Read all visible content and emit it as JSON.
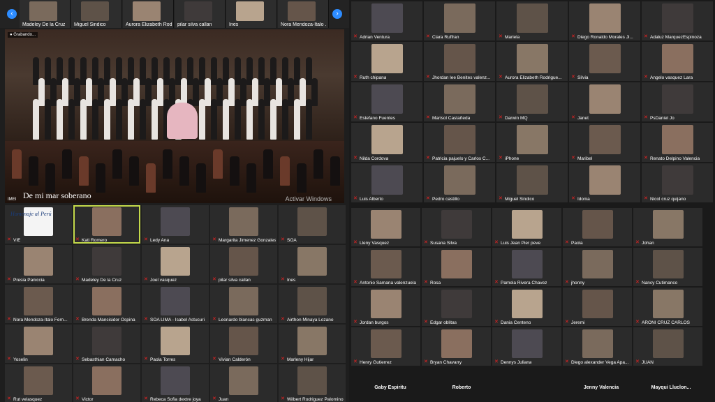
{
  "colors": {
    "accent": "#2d8cff",
    "muted_mic": "#e22222",
    "tile_bg": "#2b2b2b"
  },
  "top_strip": {
    "prev_icon": "chevron-left-icon",
    "next_icon": "chevron-right-icon",
    "participants": [
      "Madeley De la Cruz",
      "Miguel Sindico",
      "Aurora Elizabeth Rodri...",
      "pilar silva callan",
      "Ines",
      "Nora Mendoza-Italo ..."
    ]
  },
  "stage": {
    "recording_label": "Grabando...",
    "caption": "De mi mar soberano",
    "watermark": "Activar Windows",
    "active_name": "IMEI"
  },
  "left_grid": [
    {
      "name": "VIE"
    },
    {
      "name": "Kati Romero"
    },
    {
      "name": "Ledy Ana"
    },
    {
      "name": "Margarita Jimenez Gonzales"
    },
    {
      "name": "SOA"
    },
    {
      "name": "Presia Paniccia"
    },
    {
      "name": "Madeley De la Cruz"
    },
    {
      "name": "Joel vasquez"
    },
    {
      "name": "pilar silva callan"
    },
    {
      "name": "Ines"
    },
    {
      "name": "Nora Mendoza-Italo Fern..."
    },
    {
      "name": "Brenda Mancisidor Ospina"
    },
    {
      "name": "SOA LIMA - Isabel Astucuri"
    },
    {
      "name": "Leonardo blancas guzman"
    },
    {
      "name": "Airthon Minaya Lozano"
    },
    {
      "name": "Yoselin"
    },
    {
      "name": "Sebasthian Camacho"
    },
    {
      "name": "Paola Torres"
    },
    {
      "name": "Vivian Calderón"
    },
    {
      "name": "Marleny Hijar"
    },
    {
      "name": "Rut velasquez"
    },
    {
      "name": "Victor"
    },
    {
      "name": "Rebeca Sofia dextre joya"
    },
    {
      "name": "Juan"
    },
    {
      "name": "Wilbert Rodriguez Palomino"
    }
  ],
  "vie_banner": "Homenaje al Perú",
  "right_grid_top": [
    {
      "name": "Adrian Ventura"
    },
    {
      "name": "Clara Ruffran"
    },
    {
      "name": "Mariela"
    },
    {
      "name": "Diego Ronaldo Morales Ji..."
    },
    {
      "name": "Adaluz MarquezEspinoza"
    },
    {
      "name": "Ruth chipana"
    },
    {
      "name": "Jhordan lee Benites valenz..."
    },
    {
      "name": "Aurora Elizabeth Rodrigue..."
    },
    {
      "name": "Silvia"
    },
    {
      "name": "Angelo vasquez Lara"
    },
    {
      "name": "Estefano Fuentes"
    },
    {
      "name": "Marisol Castañeda"
    },
    {
      "name": "Darwin MQ"
    },
    {
      "name": "Janet"
    },
    {
      "name": "PsDaniel Jo"
    },
    {
      "name": "Nilda Cordova"
    },
    {
      "name": "Patricia pajuelo y Carlos C..."
    },
    {
      "name": "iPhone"
    },
    {
      "name": "Maribel"
    },
    {
      "name": "Renato Delpino Valencia"
    },
    {
      "name": "Luis Alberto"
    },
    {
      "name": "Pedro castillo"
    },
    {
      "name": "Miguel Sindico"
    },
    {
      "name": "Idonia"
    },
    {
      "name": "Nicol cruz quijano"
    }
  ],
  "right_grid_bottom": [
    {
      "name": "Lleny Vasquez"
    },
    {
      "name": "Susana Silva"
    },
    {
      "name": "Luis Jean Pier peve"
    },
    {
      "name": "Paola"
    },
    {
      "name": "Johan"
    },
    {
      "name": "Antonio Samana valenzuela"
    },
    {
      "name": "Rosa"
    },
    {
      "name": "Pamela Rivera Chavez"
    },
    {
      "name": "jhonny"
    },
    {
      "name": "Nancy Cutimanco"
    },
    {
      "name": "Jordan burgos"
    },
    {
      "name": "Edgar oblitas"
    },
    {
      "name": "Dania Centeno"
    },
    {
      "name": "Jeremi"
    },
    {
      "name": "ARONI CRUZ CARLOS"
    },
    {
      "name": "Henry Gutierrez"
    },
    {
      "name": "Bryan Chavarry"
    },
    {
      "name": "Dennys Juliana"
    },
    {
      "name": "Diego alexander Vega Apa..."
    },
    {
      "name": "JUAN"
    }
  ],
  "right_names_only": [
    "Gaby Espiritu",
    "Roberto",
    "Jenny Valencia",
    "Mayqui Lluclon..."
  ]
}
